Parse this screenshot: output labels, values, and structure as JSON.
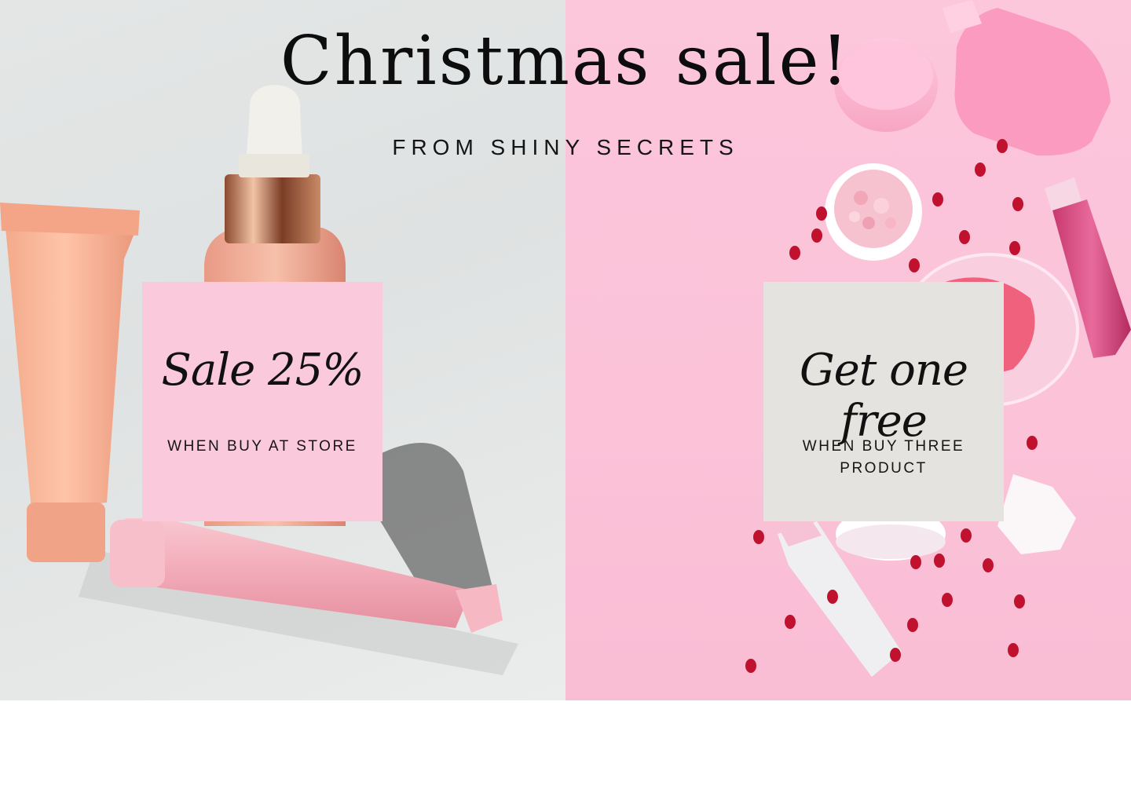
{
  "banner": {
    "title": "Christmas sale!",
    "subtitle": "FROM SHINY SECRETS"
  },
  "offers": [
    {
      "headline": "Sale 25%",
      "note": "WHEN BUY AT STORE"
    },
    {
      "headline": "Get one free",
      "note": "WHEN BUY THREE PRODUCT"
    }
  ],
  "colors": {
    "left_background": "#e2e4e4",
    "right_background": "#fbc3d9",
    "left_card": "#fbc9dc",
    "right_card": "#e5e3df",
    "text": "#111111"
  }
}
